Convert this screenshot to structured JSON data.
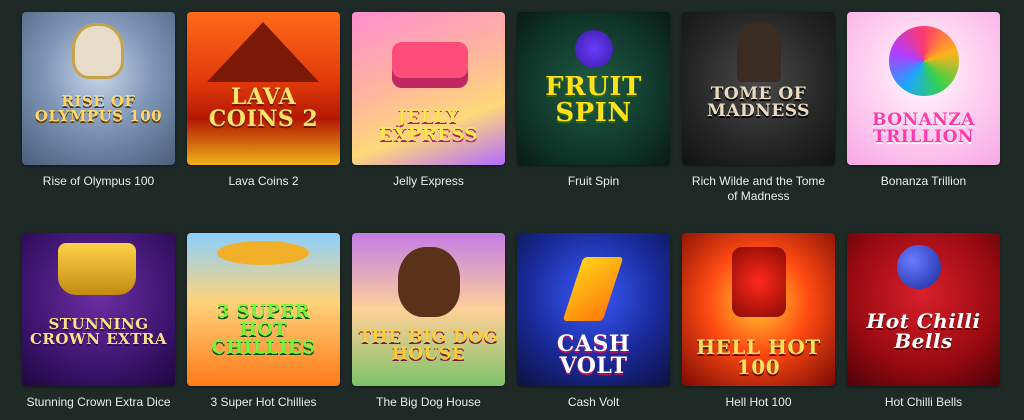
{
  "games": [
    {
      "id": "olympus",
      "title": "Rise of Olympus 100",
      "logo": "RISE OF OLYMPUS 100",
      "logo_color": "#ffd66b"
    },
    {
      "id": "lava",
      "title": "Lava Coins 2",
      "logo": "LAVA COINS 2",
      "logo_color": "#ffe36a"
    },
    {
      "id": "jelly",
      "title": "Jelly Express",
      "logo": "JELLY EXPRESS",
      "logo_color": "#ffe94a"
    },
    {
      "id": "fruit",
      "title": "Fruit Spin",
      "logo": "FRUIT SPIN",
      "logo_color": "#ffe01a"
    },
    {
      "id": "tome",
      "title": "Rich Wilde and the Tome of Madness",
      "logo": "TOME OF MADNESS",
      "logo_color": "#e8dcc0"
    },
    {
      "id": "bonanza",
      "title": "Bonanza Trillion",
      "logo": "BONANZA TRILLION",
      "logo_color": "#ff3aa8"
    },
    {
      "id": "crown",
      "title": "Stunning Crown Extra Dice",
      "logo": "STUNNING CROWN EXTRA",
      "logo_color": "#ffe08a"
    },
    {
      "id": "chillies",
      "title": "3 Super Hot Chillies",
      "logo": "3 SUPER HOT CHILLIES",
      "logo_color": "#7cf23a"
    },
    {
      "id": "dog",
      "title": "The Big Dog House",
      "logo": "THE BIG DOG HOUSE",
      "logo_color": "#ffcf3a"
    },
    {
      "id": "volt",
      "title": "Cash Volt",
      "logo": "CASH VOLT",
      "logo_color": "#ffffff"
    },
    {
      "id": "hell",
      "title": "Hell Hot 100",
      "logo": "HELL HOT 100",
      "logo_color": "#ffe15a"
    },
    {
      "id": "chilli",
      "title": "Hot Chilli Bells",
      "logo": "Hot Chilli Bells",
      "logo_color": "#ffffff"
    }
  ]
}
